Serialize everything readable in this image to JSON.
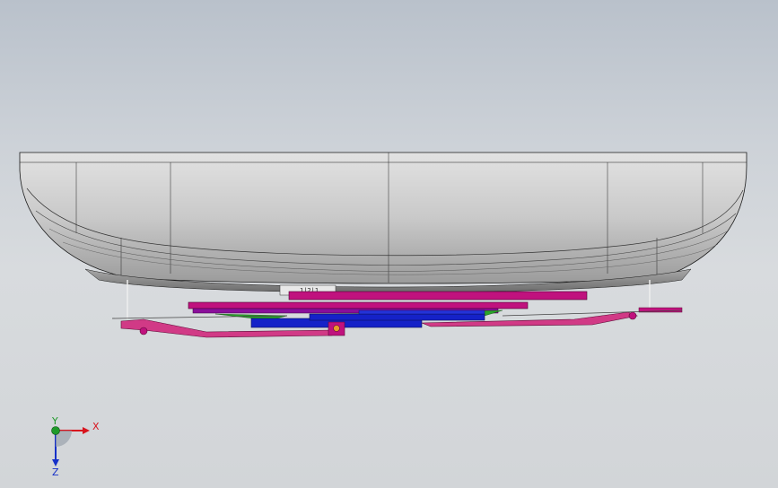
{
  "viewport": {
    "background_top": "#b9c1cb",
    "background_bottom": "#d2d5d8"
  },
  "model": {
    "hull_fill": "#d4d4d4",
    "hull_edge": "#1a1a1a",
    "part_colors": {
      "magenta": "#c0127e",
      "purple": "#8a0f9a",
      "blue": "#1522c8",
      "green": "#2aa52a",
      "pink_links": "#d13a86"
    },
    "label_text": "1|2|1"
  },
  "triad": {
    "x_label": "X",
    "y_label": "Y",
    "z_label": "Z",
    "x_color": "#d8141e",
    "y_color": "#1f9a2a",
    "z_color": "#1530c8"
  }
}
